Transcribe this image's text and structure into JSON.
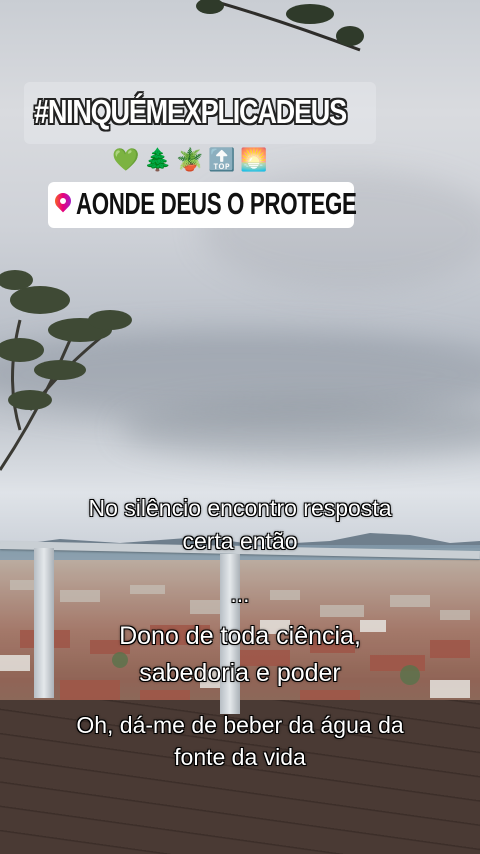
{
  "story": {
    "hashtag": "#NINQUÉMEXPLICADEUS",
    "emojis": [
      "💚",
      "🌲",
      "🪴",
      "🔝",
      "🌅"
    ],
    "emoji_names": [
      "green-heart-icon",
      "evergreen-tree-icon",
      "potted-plant-icon",
      "top-arrow-icon",
      "sunrise-icon"
    ],
    "location": {
      "label": "AONDE DEUS O PROTEGE"
    },
    "lyrics": {
      "line1a": "No silêncio encontro resposta",
      "line1b": "certa então",
      "ellipsis": "...",
      "line2a": "Dono de toda ciência,",
      "line2b": "sabedoria e poder",
      "line3a": "Oh, dá-me de beber da água da",
      "line3b": "fonte da vida"
    }
  }
}
